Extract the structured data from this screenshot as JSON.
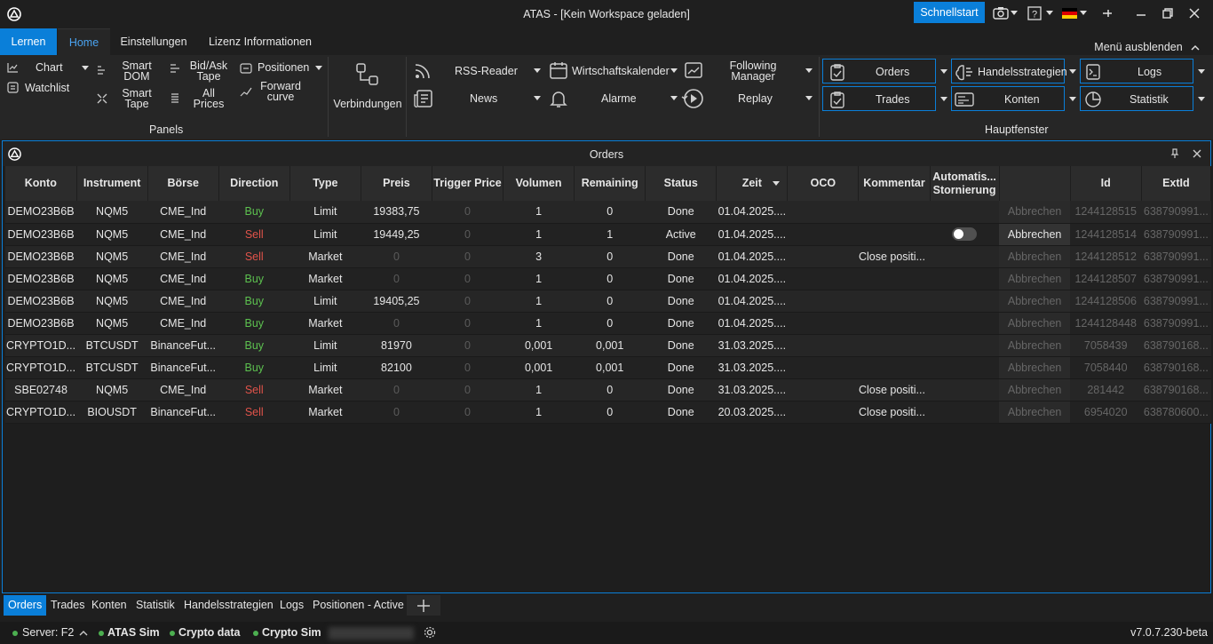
{
  "window": {
    "title": "ATAS - [Kein Workspace geladen]",
    "quick_start": "Schnellstart"
  },
  "ribbon_tabs": [
    "Lernen",
    "Home",
    "Einstellungen",
    "Lizenz Informationen"
  ],
  "hide_menu": "Menü ausblenden",
  "panels": {
    "chart": "Chart",
    "watchlist": "Watchlist",
    "smart_dom": [
      "Smart",
      "DOM"
    ],
    "smart_tape": [
      "Smart",
      "Tape"
    ],
    "bidask_tape": [
      "Bid/Ask",
      "Tape"
    ],
    "all_prices": [
      "All",
      "Prices"
    ],
    "positionen": "Positionen",
    "forward_curve": [
      "Forward",
      "curve"
    ],
    "group": "Panels"
  },
  "connections": "Verbindungen",
  "tools": {
    "rss": "RSS-Reader",
    "news": "News",
    "calendar": "Wirtschaftskalender",
    "alarms": "Alarme",
    "following": [
      "Following",
      "Manager"
    ],
    "replay": "Replay"
  },
  "main_windows": {
    "orders": "Orders",
    "trades": "Trades",
    "strategies": "Handelsstrategien",
    "accounts": "Konten",
    "logs": "Logs",
    "stats": "Statistik",
    "group": "Hauptfenster"
  },
  "orders_panel": {
    "title": "Orders",
    "columns": [
      "Konto",
      "Instrument",
      "Börse",
      "Direction",
      "Type",
      "Preis",
      "Trigger Price",
      "Volumen",
      "Remaining",
      "Status",
      "Zeit",
      "OCO",
      "Kommentar",
      "Automatis... Stornierung",
      "",
      "Id",
      "ExtId"
    ],
    "rows": [
      {
        "konto": "DEMO23B6B",
        "instrument": "NQM5",
        "boerse": "CME_Ind",
        "direction": "Buy",
        "type": "Limit",
        "preis": "19383,75",
        "trigger": "0",
        "volumen": "1",
        "remaining": "0",
        "status": "Done",
        "zeit": "01.04.2025....",
        "oco": "",
        "kommentar": "",
        "toggle": false,
        "cancel": "Abbrechen",
        "cancel_active": false,
        "id": "1244128515",
        "extid": "638790991..."
      },
      {
        "konto": "DEMO23B6B",
        "instrument": "NQM5",
        "boerse": "CME_Ind",
        "direction": "Sell",
        "type": "Limit",
        "preis": "19449,25",
        "trigger": "0",
        "volumen": "1",
        "remaining": "1",
        "status": "Active",
        "zeit": "01.04.2025....",
        "oco": "",
        "kommentar": "",
        "toggle": true,
        "cancel": "Abbrechen",
        "cancel_active": true,
        "id": "1244128514",
        "extid": "638790991..."
      },
      {
        "konto": "DEMO23B6B",
        "instrument": "NQM5",
        "boerse": "CME_Ind",
        "direction": "Sell",
        "type": "Market",
        "preis": "0",
        "trigger": "0",
        "volumen": "3",
        "remaining": "0",
        "status": "Done",
        "zeit": "01.04.2025....",
        "oco": "",
        "kommentar": "Close positi...",
        "toggle": false,
        "cancel": "Abbrechen",
        "cancel_active": false,
        "id": "1244128512",
        "extid": "638790991..."
      },
      {
        "konto": "DEMO23B6B",
        "instrument": "NQM5",
        "boerse": "CME_Ind",
        "direction": "Buy",
        "type": "Market",
        "preis": "0",
        "trigger": "0",
        "volumen": "1",
        "remaining": "0",
        "status": "Done",
        "zeit": "01.04.2025....",
        "oco": "",
        "kommentar": "",
        "toggle": false,
        "cancel": "Abbrechen",
        "cancel_active": false,
        "id": "1244128507",
        "extid": "638790991..."
      },
      {
        "konto": "DEMO23B6B",
        "instrument": "NQM5",
        "boerse": "CME_Ind",
        "direction": "Buy",
        "type": "Limit",
        "preis": "19405,25",
        "trigger": "0",
        "volumen": "1",
        "remaining": "0",
        "status": "Done",
        "zeit": "01.04.2025....",
        "oco": "",
        "kommentar": "",
        "toggle": false,
        "cancel": "Abbrechen",
        "cancel_active": false,
        "id": "1244128506",
        "extid": "638790991..."
      },
      {
        "konto": "DEMO23B6B",
        "instrument": "NQM5",
        "boerse": "CME_Ind",
        "direction": "Buy",
        "type": "Market",
        "preis": "0",
        "trigger": "0",
        "volumen": "1",
        "remaining": "0",
        "status": "Done",
        "zeit": "01.04.2025....",
        "oco": "",
        "kommentar": "",
        "toggle": false,
        "cancel": "Abbrechen",
        "cancel_active": false,
        "id": "1244128448",
        "extid": "638790991..."
      },
      {
        "konto": "CRYPTO1D...",
        "instrument": "BTCUSDT",
        "boerse": "BinanceFut...",
        "direction": "Buy",
        "type": "Limit",
        "preis": "81970",
        "trigger": "0",
        "volumen": "0,001",
        "remaining": "0,001",
        "status": "Done",
        "zeit": "31.03.2025....",
        "oco": "",
        "kommentar": "",
        "toggle": false,
        "cancel": "Abbrechen",
        "cancel_active": false,
        "id": "7058439",
        "extid": "638790168..."
      },
      {
        "konto": "CRYPTO1D...",
        "instrument": "BTCUSDT",
        "boerse": "BinanceFut...",
        "direction": "Buy",
        "type": "Limit",
        "preis": "82100",
        "trigger": "0",
        "volumen": "0,001",
        "remaining": "0,001",
        "status": "Done",
        "zeit": "31.03.2025....",
        "oco": "",
        "kommentar": "",
        "toggle": false,
        "cancel": "Abbrechen",
        "cancel_active": false,
        "id": "7058440",
        "extid": "638790168..."
      },
      {
        "konto": "SBE02748",
        "instrument": "NQM5",
        "boerse": "CME_Ind",
        "direction": "Sell",
        "type": "Market",
        "preis": "0",
        "trigger": "0",
        "volumen": "1",
        "remaining": "0",
        "status": "Done",
        "zeit": "31.03.2025....",
        "oco": "",
        "kommentar": "Close positi...",
        "toggle": false,
        "cancel": "Abbrechen",
        "cancel_active": false,
        "id": "281442",
        "extid": "638790168..."
      },
      {
        "konto": "CRYPTO1D...",
        "instrument": "BIOUSDT",
        "boerse": "BinanceFut...",
        "direction": "Sell",
        "type": "Market",
        "preis": "0",
        "trigger": "0",
        "volumen": "1",
        "remaining": "0",
        "status": "Done",
        "zeit": "20.03.2025....",
        "oco": "",
        "kommentar": "Close positi...",
        "toggle": false,
        "cancel": "Abbrechen",
        "cancel_active": false,
        "id": "6954020",
        "extid": "638780600..."
      }
    ]
  },
  "bottom_tabs": [
    "Orders",
    "Trades",
    "Konten",
    "Statistik",
    "Handelsstrategien",
    "Logs",
    "Positionen - Active"
  ],
  "status_bar": {
    "server": "Server: F2",
    "conn1": "ATAS Sim",
    "conn2": "Crypto data",
    "conn3": "Crypto Sim",
    "version": "v7.0.7.230-beta"
  },
  "colors": {
    "accent": "#0a7fd9",
    "buy": "#5cc04f",
    "sell": "#e0534a",
    "connected": "#4caf50"
  }
}
